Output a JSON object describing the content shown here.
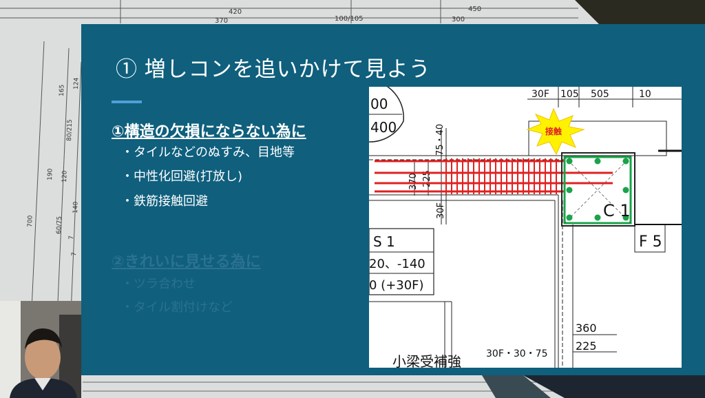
{
  "background": {
    "dims": [
      "420",
      "450",
      "370",
      "100/105",
      "300",
      "165",
      "124",
      "80/215",
      "190",
      "120",
      "700",
      "140",
      "60/75",
      "7",
      "7"
    ]
  },
  "slide": {
    "title": "① 増しコンを追いかけて見よう",
    "section1": {
      "heading": "①構造の欠損にならない為に",
      "bullets": [
        "・タイルなどのぬすみ、目地等",
        "・中性化回避(打放し)",
        "・鉄筋接触回避"
      ]
    },
    "section2": {
      "heading": "②きれいに見せる為に",
      "bullets": [
        "・ツラ合わせ",
        "・タイル割付けなど"
      ]
    }
  },
  "drawing": {
    "top_dims": [
      "30F",
      "105",
      "505",
      "10"
    ],
    "circle_labels": [
      "00",
      "400"
    ],
    "callout": "接触",
    "vertical_dim_1": "75・40",
    "vertical_dim_2": "370",
    "vertical_dim_3": "225",
    "vertical_dim_4": "30F",
    "column_label": "C 1",
    "footing_label": "F 5",
    "schedule": [
      "S 1",
      "20、-140",
      "0 (+30F)"
    ],
    "bottom_dims": [
      "360",
      "225",
      "30F・30・75"
    ],
    "beam_note": "小梁受補強"
  },
  "colors": {
    "slide_bg": "#0f5f7d",
    "rebar_red": "#e02020",
    "rebar_green": "#1aa34a",
    "callout_yellow": "#fff200"
  }
}
